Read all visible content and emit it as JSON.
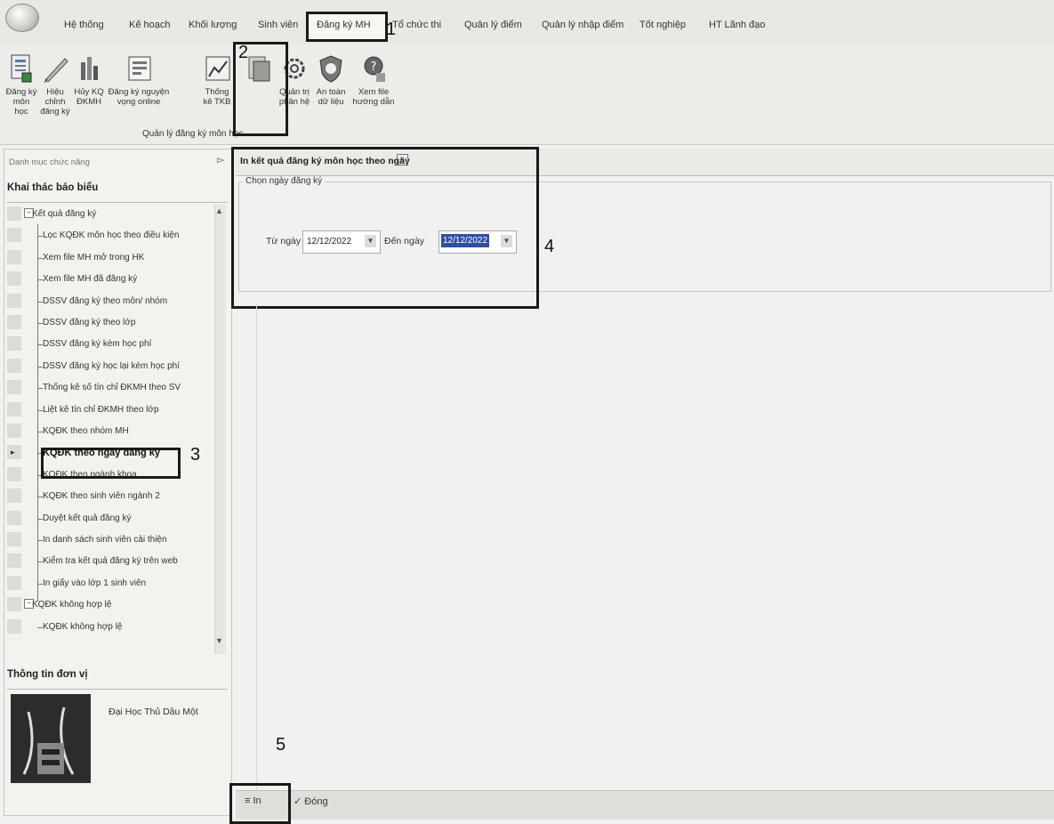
{
  "menu": {
    "items": [
      "Hệ thống",
      "Kế hoạch",
      "Khối lượng",
      "Sinh viên",
      "Đăng ký MH",
      "Tổ chức thi",
      "Quản lý điểm",
      "Quản lý nhập điểm",
      "Tốt nghiệp",
      "HT Lãnh đạo"
    ],
    "active_index": 4
  },
  "ribbon": {
    "buttons": [
      {
        "label1": "Đăng ký",
        "label2": "môn học",
        "icon": "register-form-icon"
      },
      {
        "label1": "Hiệu chỉnh",
        "label2": "đăng ký",
        "icon": "edit-pencil-icon"
      },
      {
        "label1": "Hủy KQ",
        "label2": "ĐKMH",
        "icon": "cancel-result-icon"
      },
      {
        "label1": "Đăng ký nguyện",
        "label2": "vọng online",
        "icon": "online-form-icon"
      },
      {
        "label1": "Thống",
        "label2": "kê TKB",
        "icon": "statistics-chart-icon"
      },
      {
        "label1": "",
        "label2": "",
        "icon": "report-print-icon"
      },
      {
        "label1": "Quản trị",
        "label2": "phân hệ",
        "icon": "gear-icon"
      },
      {
        "label1": "An toàn",
        "label2": "dữ liệu",
        "icon": "shield-icon"
      },
      {
        "label1": "Xem file",
        "label2": "hướng dẫn",
        "icon": "help-icon"
      }
    ],
    "group_label": "Quản lý đăng ký môn học"
  },
  "left": {
    "search_placeholder": "Danh mục chức năng",
    "section1": "Khai thác báo biểu",
    "tree": [
      {
        "label": "Kết quả đăng ký",
        "level": 1,
        "expander": "−"
      },
      {
        "label": "Lọc KQĐK môn học theo điều kiện",
        "level": 2
      },
      {
        "label": "Xem file MH mở trong HK",
        "level": 2
      },
      {
        "label": "Xem file MH đã đăng ký",
        "level": 2
      },
      {
        "label": "DSSV đăng ký theo môn/ nhóm",
        "level": 2
      },
      {
        "label": "DSSV đăng ký theo lớp",
        "level": 2
      },
      {
        "label": "DSSV đăng ký kèm học phí",
        "level": 2
      },
      {
        "label": "DSSV đăng ký học lại kèm học phí",
        "level": 2
      },
      {
        "label": "Thống kê số tín chỉ ĐKMH theo SV",
        "level": 2
      },
      {
        "label": "Liệt kê tín chỉ ĐKMH theo lớp",
        "level": 2
      },
      {
        "label": "KQĐK theo nhóm MH",
        "level": 2
      },
      {
        "label": "KQĐK theo ngày đăng ký",
        "level": 2,
        "selected": true
      },
      {
        "label": "KQĐK theo ngành khoa",
        "level": 2
      },
      {
        "label": "KQĐK theo sinh viên ngành 2",
        "level": 2
      },
      {
        "label": "Duyệt kết quả đăng ký",
        "level": 2
      },
      {
        "label": "In danh sách sinh viên cải thiện",
        "level": 2
      },
      {
        "label": "Kiểm tra kết quả đăng ký trên web",
        "level": 2
      },
      {
        "label": "In giấy vào lớp 1 sinh viên",
        "level": 2
      },
      {
        "label": "KQĐK không hợp lệ",
        "level": 1,
        "expander": "−"
      },
      {
        "label": "KQĐK không hợp lệ",
        "level": 2
      }
    ],
    "section2": "Thông tin đơn vị",
    "unit_name": "Đại Học Thủ Dầu Một"
  },
  "doc": {
    "title": "In kết quả đăng ký môn học theo ngày",
    "group_label": "Chọn ngày đăng ký",
    "from_label": "Từ ngày",
    "from_value": "12/12/2022",
    "to_label": "Đến ngày",
    "to_value": "12/12/2022"
  },
  "bottom": {
    "print_label": "In",
    "close_label": "Đóng"
  },
  "callouts": [
    "1",
    "2",
    "3",
    "4",
    "5"
  ]
}
